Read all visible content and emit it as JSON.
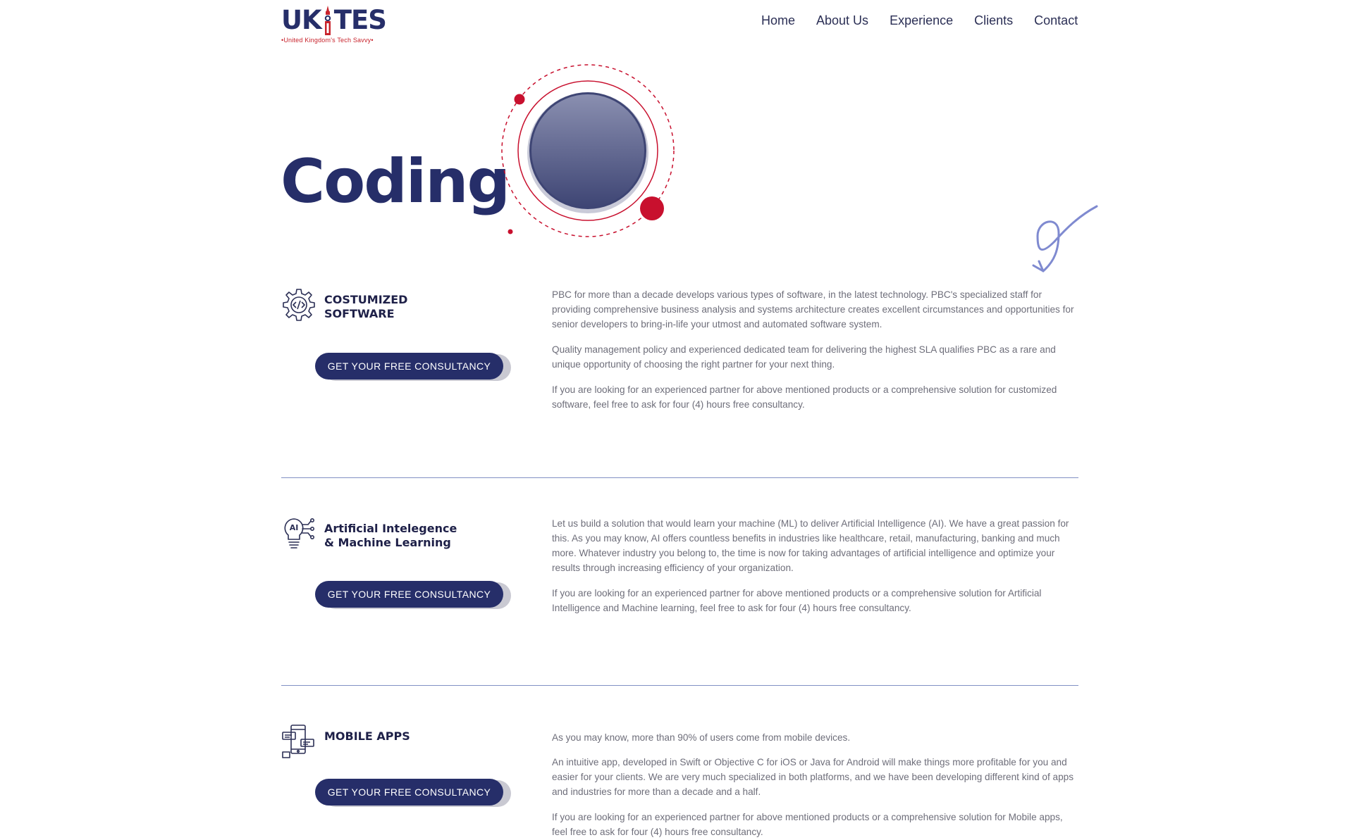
{
  "header": {
    "logo": {
      "text_before": "UK",
      "text_after": "TES",
      "tagline": "•United Kingdom's Tech Savvy•"
    },
    "nav": [
      {
        "label": "Home"
      },
      {
        "label": "About Us"
      },
      {
        "label": "Experience"
      },
      {
        "label": "Clients"
      },
      {
        "label": "Contact"
      }
    ]
  },
  "hero": {
    "title": "Coding"
  },
  "colors": {
    "brand_navy": "#262e69",
    "brand_red": "#c8102e",
    "divider": "#8190c4"
  },
  "services": [
    {
      "icon": "gear-code-icon",
      "title_line1": "COSTUMIZED",
      "title_line2": "SOFTWARE",
      "button": "GET YOUR FREE CONSULTANCY",
      "paragraphs": [
        "PBC for more than a decade develops various types of software, in the latest technology. PBC's specialized staff for providing comprehensive business analysis and systems architecture creates excellent circumstances and opportunities for senior developers to bring-in-life your utmost and automated software system.",
        "Quality management policy and experienced dedicated team for delivering the highest SLA qualifies PBC as a rare and unique opportunity of choosing the right partner for your next thing.",
        "If you are looking for an experienced partner for above mentioned products or a comprehensive solution for customized software, feel free to ask for four (4) hours free consultancy."
      ]
    },
    {
      "icon": "ai-bulb-icon",
      "title_line1": "Artificial Intelegence",
      "title_line2": "& Machine Learning",
      "button": "GET YOUR FREE CONSULTANCY",
      "paragraphs": [
        "Let us build a solution that would learn your machine (ML) to deliver Artificial Intelligence (AI). We have a great passion for this. As you may know, AI offers countless benefits in industries like healthcare, retail, manufacturing, banking and much more. Whatever industry you belong to, the time is now for taking advantages of artificial intelligence and optimize your results through increasing efficiency of your organization.",
        "If you are looking for an experienced partner for above mentioned products or a comprehensive solution for Artificial Intelligence and Machine learning, feel free to ask for four (4) hours free consultancy."
      ]
    },
    {
      "icon": "mobile-app-icon",
      "title_line1": "MOBILE APPS",
      "title_line2": "",
      "button": "GET YOUR FREE CONSULTANCY",
      "paragraphs": [
        "As you may know, more than 90% of users come from mobile devices.",
        "An intuitive app, developed in Swift or Objective C for iOS or Java for Android will make things more profitable for you and easier for your clients. We are very much specialized in both platforms, and we have been developing different kind of apps and industries for more than a decade and a half.",
        "If you are looking for an experienced partner for above mentioned products or a comprehensive solution for Mobile apps, feel free to ask for four (4) hours free consultancy."
      ]
    }
  ]
}
